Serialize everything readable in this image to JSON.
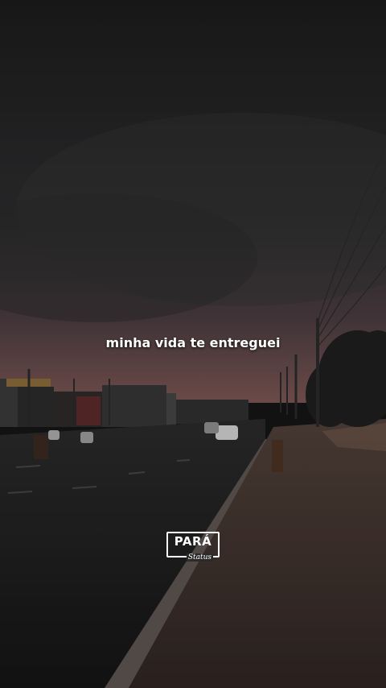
{
  "caption": "minha vida te entreguei",
  "logo": {
    "main": "PARÁ",
    "script": "Status"
  },
  "colors": {
    "sky_top": "#1b1b1b",
    "sky_glow": "#6a4a4c",
    "road": "#242424",
    "sidewalk": "#4a3b35"
  }
}
